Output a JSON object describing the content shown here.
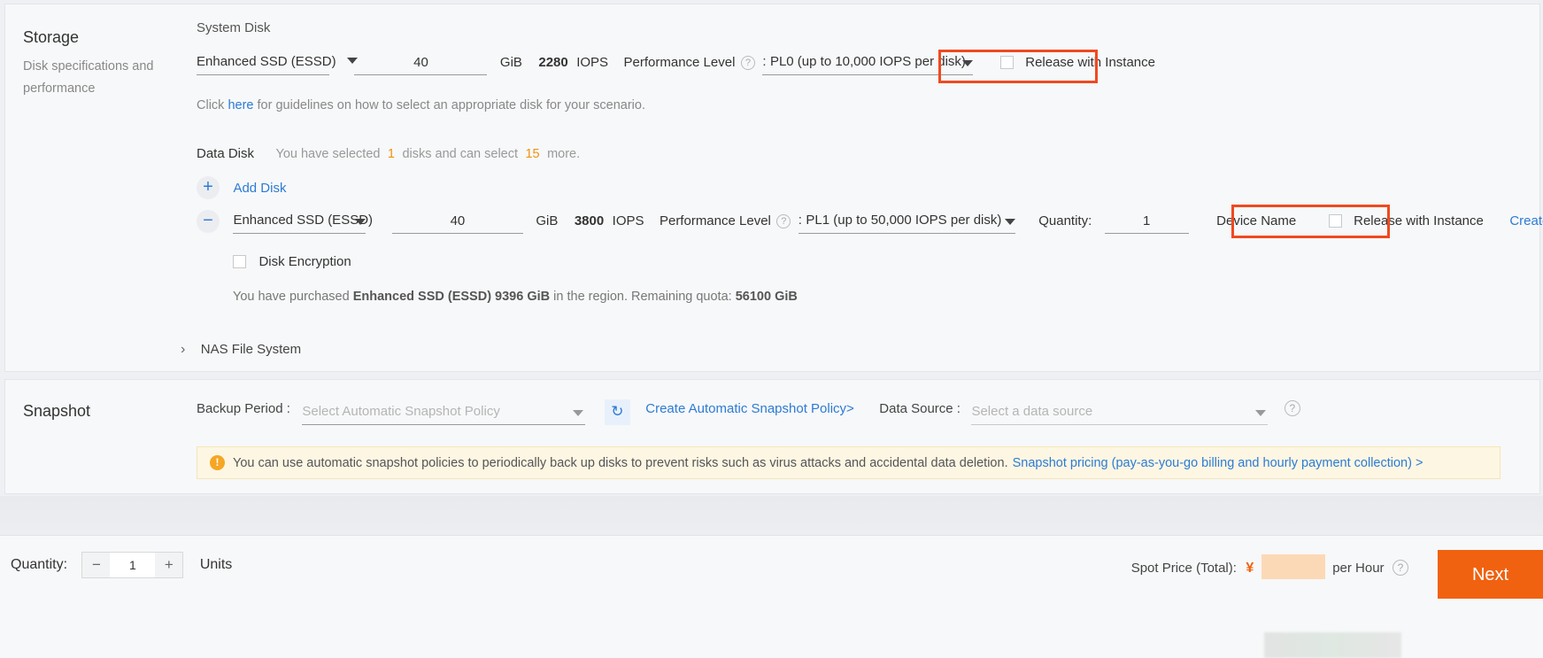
{
  "storage": {
    "title": "Storage",
    "subtitle": "Disk specifications and performance",
    "system_disk": {
      "label": "System Disk",
      "disk_type": "Enhanced SSD (ESSD)",
      "size": "40",
      "unit": "GiB",
      "iops_value": "2280",
      "iops_unit": "IOPS",
      "perf_label": "Performance Level",
      "perf_colon": ":",
      "perf_value": "PL0 (up to 10,000 IOPS per disk)",
      "release_label": "Release with Instance",
      "hint_prefix": "Click",
      "hint_link": "here",
      "hint_suffix": "for guidelines on how to select an appropriate disk for your scenario."
    },
    "data_disk": {
      "label": "Data Disk",
      "selected_prefix": "You have selected",
      "selected_count": "1",
      "selected_mid": "disks and can select",
      "remaining_count": "15",
      "selected_suffix": "more.",
      "add_disk_label": "Add Disk",
      "add_icon": "plus-icon",
      "remove_icon": "minus-icon",
      "disk_type": "Enhanced SSD (ESSD)",
      "size": "40",
      "unit": "GiB",
      "iops_value": "3800",
      "iops_unit": "IOPS",
      "perf_label": "Performance Level",
      "perf_colon": ":",
      "perf_value": "PL1 (up to 50,000 IOPS per disk)",
      "quantity_label": "Quantity:",
      "quantity_value": "1",
      "device_name_label": "Device Name",
      "release_label": "Release with Instance",
      "create_from_snapshot": "Create from Snapshot",
      "disk_encryption_label": "Disk Encryption",
      "quota_prefix": "You have purchased",
      "quota_bold": "Enhanced SSD (ESSD) 9396 GiB",
      "quota_mid": "in the region. Remaining quota:",
      "quota_value": "56100 GiB"
    },
    "nas": {
      "label": "NAS File System",
      "chevron": "chevron-right-icon"
    }
  },
  "snapshot": {
    "title": "Snapshot",
    "backup_period_label": "Backup Period :",
    "backup_period_placeholder": "Select Automatic Snapshot Policy",
    "refresh_icon": "refresh-icon",
    "create_policy_link": "Create Automatic Snapshot Policy>",
    "data_source_label": "Data Source :",
    "data_source_placeholder": "Select a data source",
    "help_icon": "question-circle-icon",
    "notice_text": "You can use automatic snapshot policies to periodically back up disks to prevent risks such as virus attacks and accidental data deletion.",
    "notice_link": "Snapshot pricing (pay-as-you-go billing and hourly payment collection) >"
  },
  "footer": {
    "quantity_label": "Quantity:",
    "quantity_value": "1",
    "minus": "−",
    "plus": "+",
    "units_label": "Units",
    "spot_price_label": "Spot Price (Total):",
    "currency": "¥",
    "per_hour_label": "per Hour",
    "help_icon": "question-circle-icon",
    "next_label": "Next"
  },
  "colors": {
    "accent_orange": "#f0620f",
    "highlight_box": "#ef4a21",
    "link_blue": "#2d7bd4",
    "warning_bg": "#fdf6e3"
  }
}
